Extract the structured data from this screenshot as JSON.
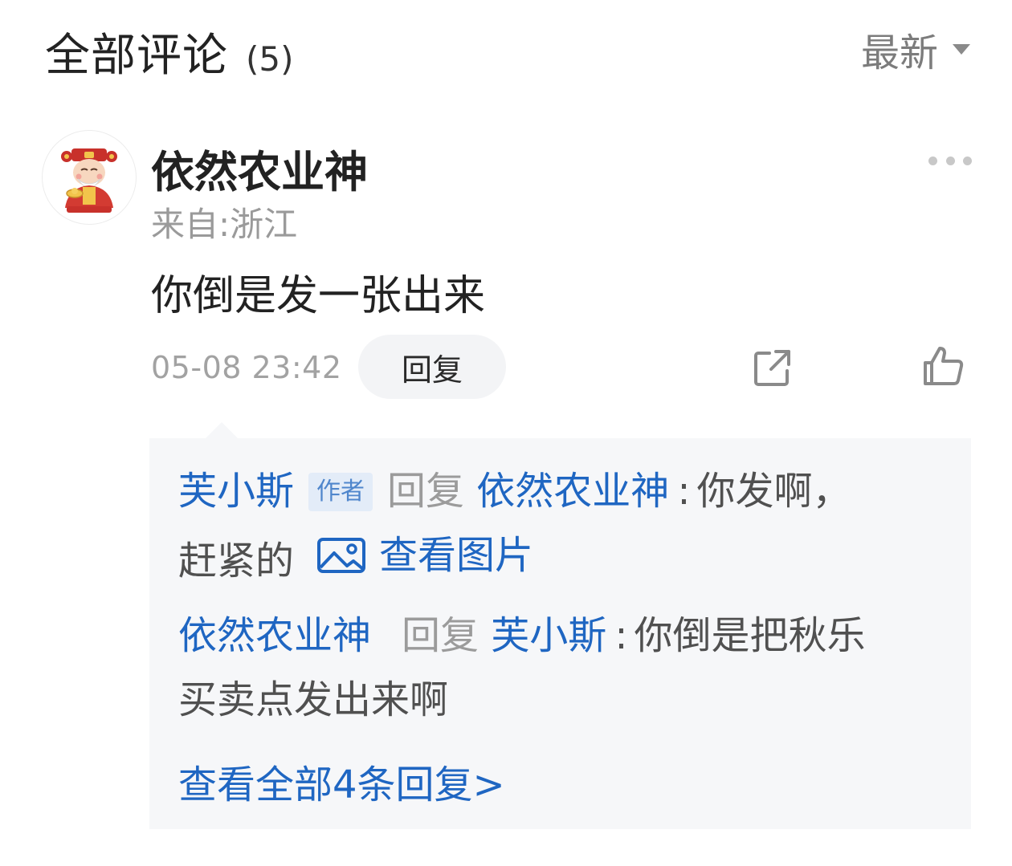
{
  "header": {
    "title": "全部评论",
    "count": "(5)",
    "sort_label": "最新"
  },
  "comment": {
    "username": "依然农业神",
    "location": "来自:浙江",
    "text": "你倒是发一张出来",
    "timestamp": "05-08 23:42",
    "reply_label": "回复"
  },
  "replies": [
    {
      "author": "芙小斯",
      "badge": "作者",
      "action": "回复",
      "target": "依然农业神",
      "text_line1": "你发啊，",
      "text_line2": "赶紧的",
      "image_link_label": "查看图片"
    },
    {
      "author": "依然农业神",
      "action": "回复",
      "target": "芙小斯",
      "text_line1": "你倒是把秋乐",
      "text_line2": "买卖点发出来啊"
    }
  ],
  "view_all_label": "查看全部4条回复>",
  "colors": {
    "link_blue": "#1f66c2",
    "reply_bg": "#f6f7f9",
    "muted_gray": "#9b9b9b"
  },
  "icons": {
    "sort": "caret-down-icon",
    "more": "more-dots-icon",
    "share": "share-icon",
    "like": "thumbs-up-icon",
    "image": "image-icon"
  }
}
